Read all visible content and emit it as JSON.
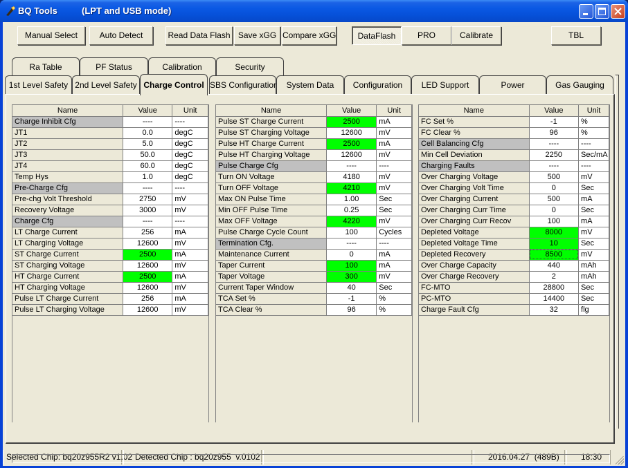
{
  "window": {
    "title": "BQ Tools",
    "mode": "(LPT and USB mode)",
    "controls": [
      "minimize",
      "maximize",
      "close"
    ]
  },
  "toolbar": {
    "manual_select": "Manual Select",
    "auto_detect": "Auto Detect",
    "read_data_flash": "Read Data Flash",
    "save_xgg": "Save xGG",
    "compare_xgg": "Compare xGG",
    "dataflash": "DataFlash",
    "pro": "PRO",
    "calibrate": "Calibrate",
    "tbl": "TBL",
    "active_mode": "DataFlash"
  },
  "tabs": {
    "row1": [
      "Ra Table",
      "PF Status",
      "Calibration",
      "Security"
    ],
    "row2": [
      "1st Level Safety",
      "2nd Level Safety",
      "Charge Control",
      "SBS Configuration",
      "System Data",
      "Configuration",
      "LED Support",
      "Power",
      "Gas Gauging"
    ],
    "active": "Charge Control"
  },
  "grid_headers": {
    "name": "Name",
    "value": "Value",
    "unit": "Unit"
  },
  "highlight_color": "#00ff00",
  "group_color": "#c0c0c0",
  "tables": [
    {
      "rows": [
        {
          "name": "Charge Inhibit Cfg",
          "value": "----",
          "unit": "----",
          "group": true
        },
        {
          "name": "JT1",
          "value": "0.0",
          "unit": "degC"
        },
        {
          "name": "JT2",
          "value": "5.0",
          "unit": "degC"
        },
        {
          "name": "JT3",
          "value": "50.0",
          "unit": "degC"
        },
        {
          "name": "JT4",
          "value": "60.0",
          "unit": "degC"
        },
        {
          "name": "Temp Hys",
          "value": "1.0",
          "unit": "degC"
        },
        {
          "name": "Pre-Charge Cfg",
          "value": "----",
          "unit": "----",
          "group": true
        },
        {
          "name": "Pre-chg Volt Threshold",
          "value": "2750",
          "unit": "mV"
        },
        {
          "name": "Recovery Voltage",
          "value": "3000",
          "unit": "mV"
        },
        {
          "name": "Charge Cfg",
          "value": "----",
          "unit": "----",
          "group": true
        },
        {
          "name": "LT Charge Current",
          "value": "256",
          "unit": "mA"
        },
        {
          "name": "LT Charging Voltage",
          "value": "12600",
          "unit": "mV"
        },
        {
          "name": "ST Charge Current",
          "value": "2500",
          "unit": "mA",
          "highlight": true
        },
        {
          "name": "ST Charging Voltage",
          "value": "12600",
          "unit": "mV"
        },
        {
          "name": "HT Charge Current",
          "value": "2500",
          "unit": "mA",
          "highlight": true
        },
        {
          "name": "HT Charging Voltage",
          "value": "12600",
          "unit": "mV"
        },
        {
          "name": "Pulse LT Charge Current",
          "value": "256",
          "unit": "mA"
        },
        {
          "name": "Pulse LT Charging Voltage",
          "value": "12600",
          "unit": "mV"
        }
      ]
    },
    {
      "rows": [
        {
          "name": "Pulse ST Charge Current",
          "value": "2500",
          "unit": "mA",
          "highlight": true
        },
        {
          "name": "Pulse ST Charging Voltage",
          "value": "12600",
          "unit": "mV"
        },
        {
          "name": "Pulse HT Charge Current",
          "value": "2500",
          "unit": "mA",
          "highlight": true
        },
        {
          "name": "Pulse HT Charging Voltage",
          "value": "12600",
          "unit": "mV"
        },
        {
          "name": "Pulse Charge Cfg",
          "value": "----",
          "unit": "----",
          "group": true
        },
        {
          "name": "Turn ON Voltage",
          "value": "4180",
          "unit": "mV"
        },
        {
          "name": "Turn OFF Voltage",
          "value": "4210",
          "unit": "mV",
          "highlight": true
        },
        {
          "name": "Max ON Pulse Time",
          "value": "1.00",
          "unit": "Sec"
        },
        {
          "name": "Min OFF Pulse Time",
          "value": "0.25",
          "unit": "Sec"
        },
        {
          "name": "Max OFF Voltage",
          "value": "4220",
          "unit": "mV",
          "highlight": true
        },
        {
          "name": "Pulse Charge Cycle Count",
          "value": "100",
          "unit": "Cycles"
        },
        {
          "name": "Termination Cfg.",
          "value": "----",
          "unit": "----",
          "group": true
        },
        {
          "name": "Maintenance Current",
          "value": "0",
          "unit": "mA"
        },
        {
          "name": "Taper Current",
          "value": "100",
          "unit": "mA",
          "highlight": true
        },
        {
          "name": "Taper Voltage",
          "value": "300",
          "unit": "mV",
          "highlight": true
        },
        {
          "name": "Current Taper Window",
          "value": "40",
          "unit": "Sec"
        },
        {
          "name": "TCA Set %",
          "value": "-1",
          "unit": "%"
        },
        {
          "name": "TCA Clear %",
          "value": "96",
          "unit": "%"
        }
      ]
    },
    {
      "rows": [
        {
          "name": "FC Set %",
          "value": "-1",
          "unit": "%"
        },
        {
          "name": "FC Clear %",
          "value": "96",
          "unit": "%"
        },
        {
          "name": "Cell Balancing Cfg",
          "value": "----",
          "unit": "----",
          "group": true
        },
        {
          "name": "Min Cell Deviation",
          "value": "2250",
          "unit": "Sec/mA"
        },
        {
          "name": "Charging Faults",
          "value": "----",
          "unit": "----",
          "group": true
        },
        {
          "name": "Over Charging Voltage",
          "value": "500",
          "unit": "mV"
        },
        {
          "name": "Over Charging Volt Time",
          "value": "0",
          "unit": "Sec"
        },
        {
          "name": "Over Charging Current",
          "value": "500",
          "unit": "mA"
        },
        {
          "name": "Over Charging Curr Time",
          "value": "0",
          "unit": "Sec"
        },
        {
          "name": "Over Charging Curr Recov",
          "value": "100",
          "unit": "mA"
        },
        {
          "name": "Depleted Voltage",
          "value": "8000",
          "unit": "mV",
          "highlight": true
        },
        {
          "name": "Depleted Voltage Time",
          "value": "10",
          "unit": "Sec",
          "highlight": true
        },
        {
          "name": "Depleted Recovery",
          "value": "8500",
          "unit": "mV",
          "highlight": true,
          "focused": true
        },
        {
          "name": "Over Charge Capacity",
          "value": "440",
          "unit": "mAh"
        },
        {
          "name": "Over Charge Recovery",
          "value": "2",
          "unit": "mAh"
        },
        {
          "name": "FC-MTO",
          "value": "28800",
          "unit": "Sec"
        },
        {
          "name": "PC-MTO",
          "value": "14400",
          "unit": "Sec"
        },
        {
          "name": "Charge Fault Cfg",
          "value": "32",
          "unit": "flg"
        }
      ]
    }
  ],
  "status": {
    "selected_chip": "Selected Chip: bq20z955R2 v1.02",
    "detected_chip": "Detected Chip : bq20z955  v.0102",
    "empty": "",
    "date": "2016.04.27  (489B)",
    "time": "18:30"
  }
}
